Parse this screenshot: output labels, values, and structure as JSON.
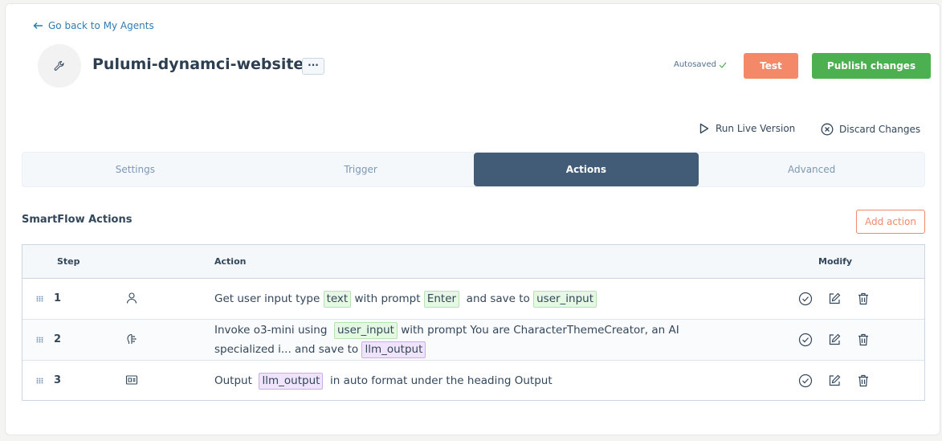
{
  "nav": {
    "back_label": "Go back to My Agents"
  },
  "agent": {
    "title": "Pulumi-dynamci-website",
    "more_label": "···"
  },
  "header": {
    "autosaved": "Autosaved",
    "test_label": "Test",
    "publish_label": "Publish changes"
  },
  "toolbar": {
    "run_live_label": "Run Live Version",
    "discard_label": "Discard Changes"
  },
  "tabs": [
    {
      "label": "Settings",
      "active": false
    },
    {
      "label": "Trigger",
      "active": false
    },
    {
      "label": "Actions",
      "active": true
    },
    {
      "label": "Advanced",
      "active": false
    }
  ],
  "section": {
    "title": "SmartFlow Actions",
    "add_label": "Add action"
  },
  "table": {
    "headers": {
      "step": "Step",
      "action": "Action",
      "modify": "Modify"
    },
    "rows": [
      {
        "step": "1",
        "icon": "user-icon",
        "parts": [
          {
            "t": "Get user input type "
          },
          {
            "tag": "text",
            "c": "green"
          },
          {
            "t": " with prompt "
          },
          {
            "tag": "Enter",
            "c": "green"
          },
          {
            "t": "  and save to "
          },
          {
            "tag": "user_input",
            "c": "green"
          }
        ]
      },
      {
        "step": "2",
        "icon": "brain-icon",
        "parts": [
          {
            "t": "Invoke o3-mini using  "
          },
          {
            "tag": "user_input",
            "c": "green"
          },
          {
            "t": "  with prompt You are CharacterThemeCreator, an AI specialized i... and save to  "
          },
          {
            "tag": "llm_output",
            "c": "purple"
          }
        ]
      },
      {
        "step": "3",
        "icon": "output-icon",
        "parts": [
          {
            "t": "Output  "
          },
          {
            "tag": "llm_output",
            "c": "purple"
          },
          {
            "t": "  in auto format under the heading Output"
          }
        ]
      }
    ]
  },
  "colors": {
    "accent": "#425b76",
    "test": "#f4896a",
    "publish": "#4caf50",
    "link": "#2f7cb3"
  }
}
